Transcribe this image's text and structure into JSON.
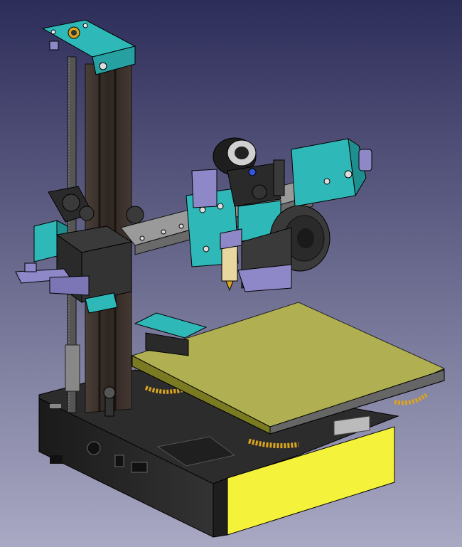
{
  "viewport": {
    "background_top": "#2d2d5a",
    "background_bottom": "#a9a9c4"
  },
  "model": {
    "teal": "#2fb8b8",
    "dark": "#2a2a2a",
    "extrusion": "#3a302c",
    "lavender": "#8f88c8",
    "bed_surface": "#b0b052",
    "gold": "#d9a41e",
    "base_highlight": "#f5f23b",
    "rail": "#b8b8b8"
  }
}
